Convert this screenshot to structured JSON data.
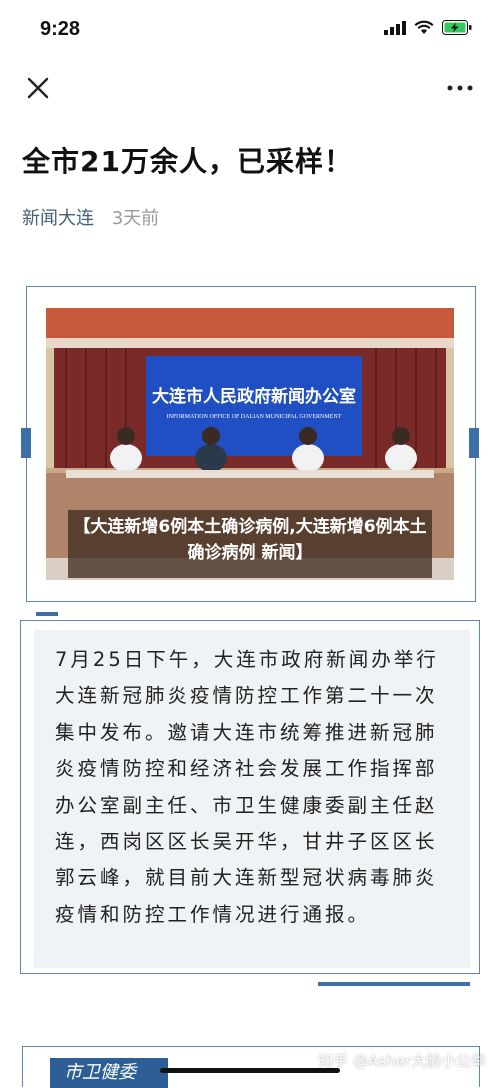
{
  "status_bar": {
    "time": "9:28"
  },
  "article": {
    "title": "全市21万余人，已采样！",
    "source": "新闻大连",
    "date": "3天前"
  },
  "image": {
    "banner_cn": "大连市人民政府新闻办公室",
    "banner_en": "INFORMATION OFFICE OF DALIAN MUNICIPAL GOVERNMENT",
    "caption": "【大连新增6例本土确诊病例,大连新增6例本土确诊病例 新闻】"
  },
  "body_lines": [
    "7月25日下午，大连市政府新闻办举行",
    "大连新冠肺炎疫情防控工作第二十一次",
    "集中发布。邀请大连市统筹推进新冠肺",
    "炎疫情防控和经济社会发展工作指挥部",
    "办公室副主任、市卫生健康委副主任赵",
    "连，西岗区区长吴开华，甘井子区区长",
    "郭云峰，就目前大连新型冠状病毒肺炎",
    "疫情和防控工作情况进行通报。"
  ],
  "next_section": {
    "label": "市卫健委"
  },
  "watermark": "知乎 @Asher大龄小公举",
  "icons": {
    "close": "close-icon",
    "more": "more-icon",
    "signal": "signal-icon",
    "wifi": "wifi-icon",
    "battery": "battery-charging-icon"
  }
}
